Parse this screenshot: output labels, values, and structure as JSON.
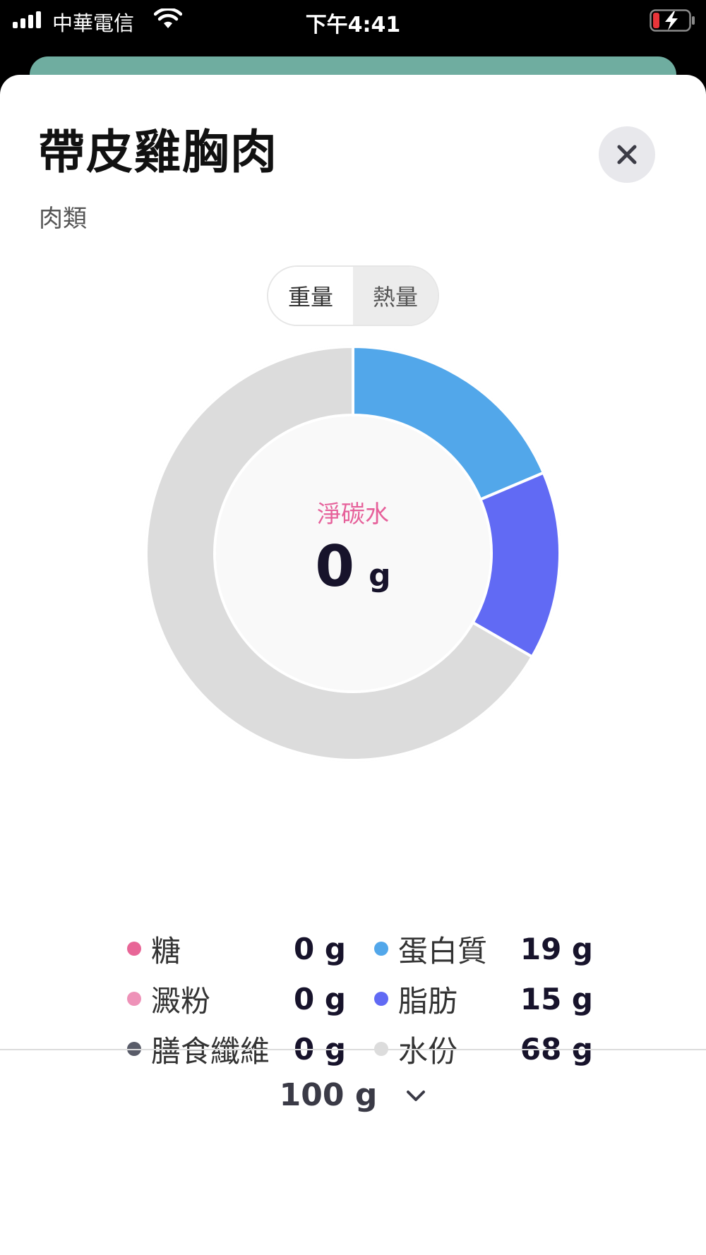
{
  "status_bar": {
    "carrier": "中華電信",
    "time": "下午4:41"
  },
  "food": {
    "title": "帶皮雞胸肉",
    "category": "肉類"
  },
  "toggle": {
    "options": [
      "重量",
      "熱量"
    ],
    "selected": "重量"
  },
  "center": {
    "label": "淨碳水",
    "value": "0",
    "unit": "g"
  },
  "chart_data": {
    "type": "pie",
    "series": [
      {
        "name": "蛋白質",
        "value": 19,
        "color": "#52a7ea"
      },
      {
        "name": "脂肪",
        "value": 15,
        "color": "#616af4"
      },
      {
        "name": "水份",
        "value": 68,
        "color": "#dcdcdc"
      },
      {
        "name": "糖",
        "value": 0,
        "color": "#e86697"
      },
      {
        "name": "澱粉",
        "value": 0,
        "color": "#ee92b8"
      },
      {
        "name": "膳食纖維",
        "value": 0,
        "color": "#595c69"
      }
    ],
    "unit": "g"
  },
  "legend": {
    "left": [
      {
        "name": "糖",
        "value": "0 g",
        "color": "#e86697"
      },
      {
        "name": "澱粉",
        "value": "0 g",
        "color": "#ee92b8"
      },
      {
        "name": "膳食纖維",
        "value": "0 g",
        "color": "#595c69"
      }
    ],
    "right": [
      {
        "name": "蛋白質",
        "value": "19 g",
        "color": "#52a7ea"
      },
      {
        "name": "脂肪",
        "value": "15 g",
        "color": "#616af4"
      },
      {
        "name": "水份",
        "value": "68 g",
        "color": "#dcdcdc"
      }
    ]
  },
  "portion": {
    "amount": "100 g"
  },
  "colors": {
    "header_peek": "#6fada0",
    "center_label": "#e6609a"
  }
}
